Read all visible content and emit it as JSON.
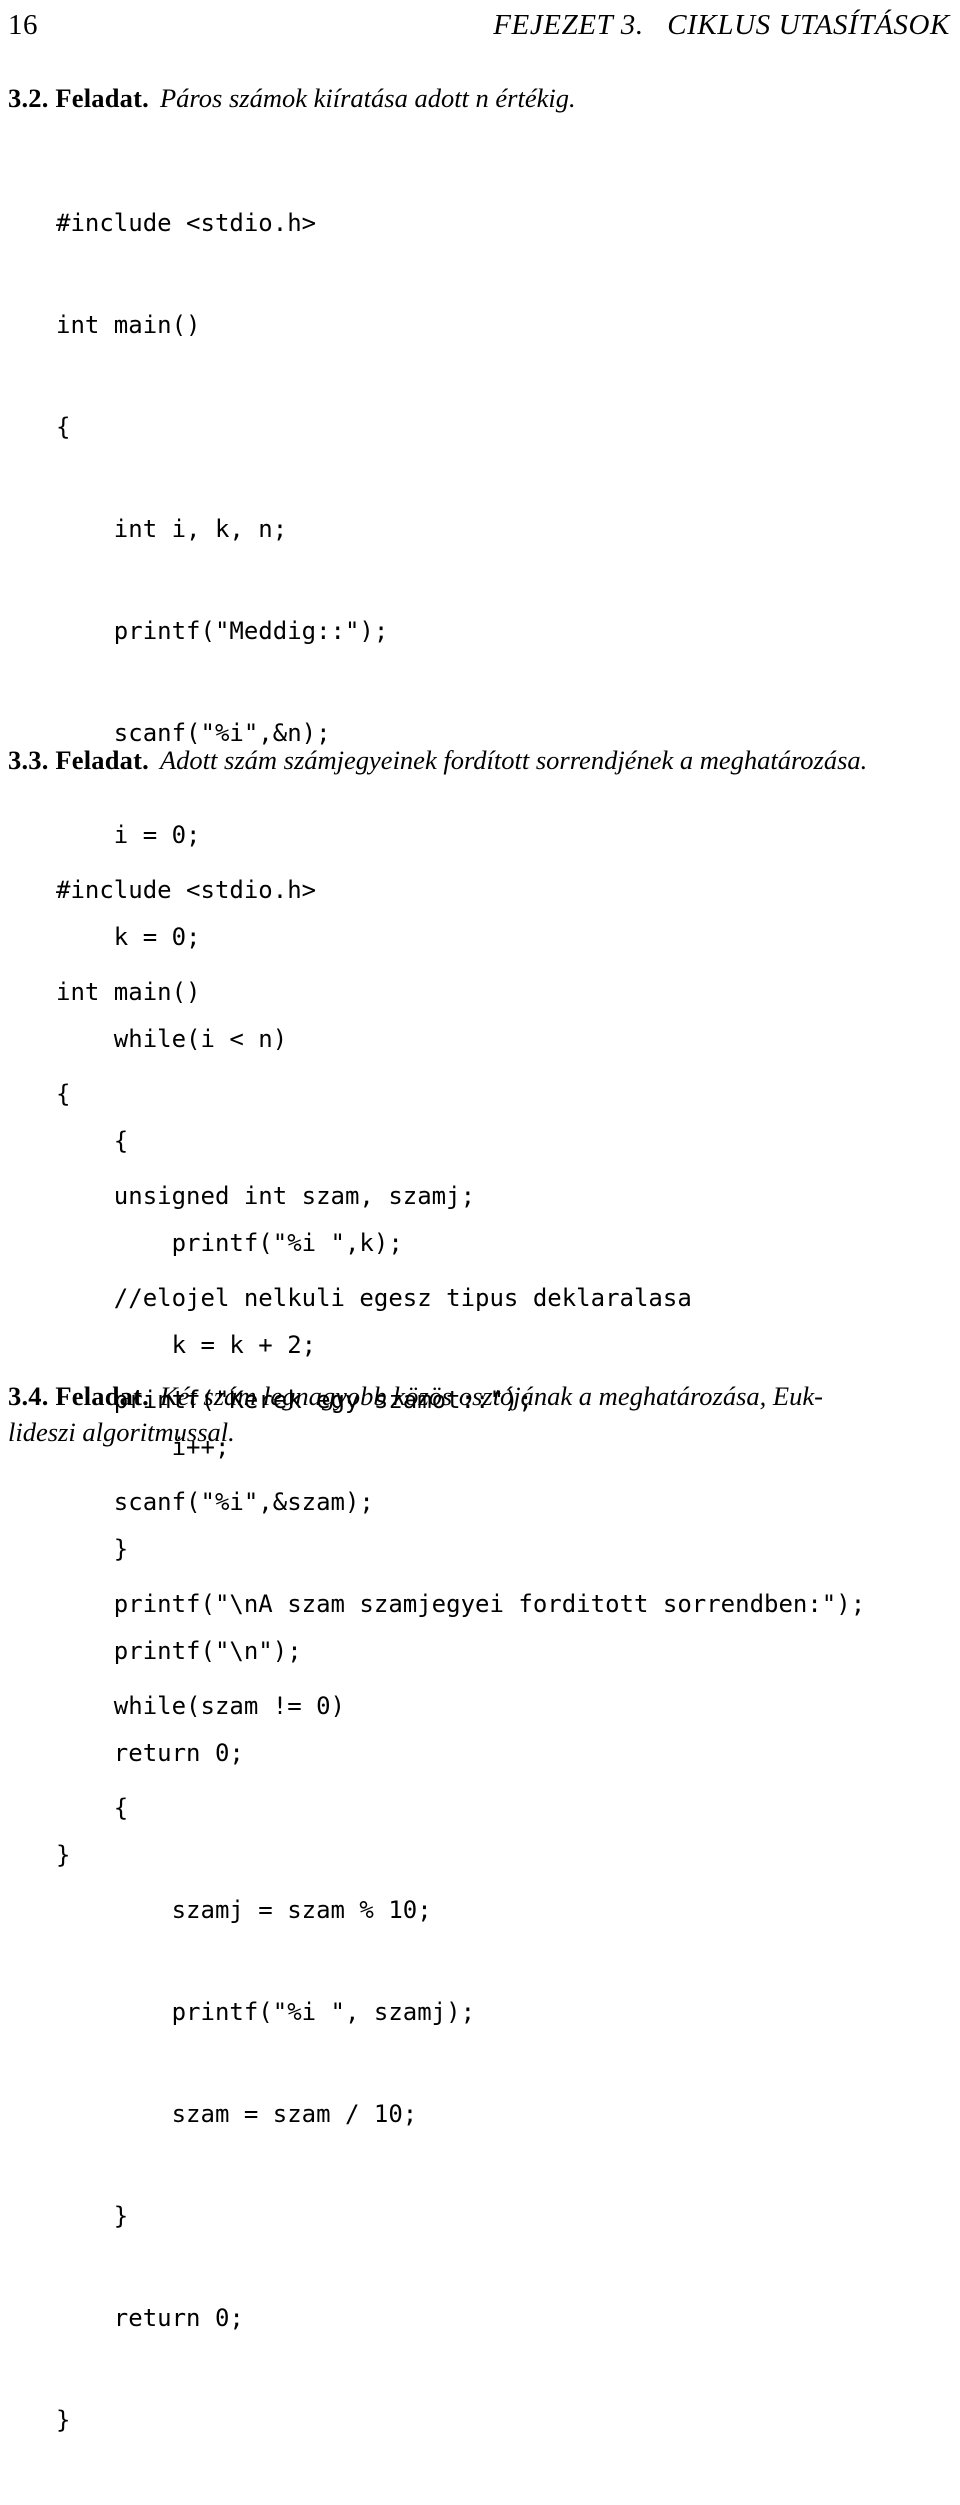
{
  "page": {
    "folio": "16",
    "running_head": "FEJEZET 3.   CIKLUS UTASÍTÁSOK"
  },
  "exercises": [
    {
      "number": "3.2. Feladat.",
      "text": "Páros számok kiíratása adott n értékig."
    },
    {
      "number": "3.3. Feladat.",
      "text": "Adott szám számjegyeinek fordított sorrendjének a meghatározása."
    },
    {
      "number": "3.4. Feladat.",
      "text_line1": "Két szám legnagyobb közös osztójának a meghatározása, Euk-",
      "text_line2": "lideszi algoritmussal."
    }
  ],
  "code_blocks": [
    {
      "lines": [
        "#include <stdio.h>",
        "int main()",
        "{",
        "    int i, k, n;",
        "    printf(\"Meddig::\");",
        "    scanf(\"%i\",&n);",
        "    i = 0;",
        "    k = 0;",
        "    while(i < n)",
        "    {",
        "        printf(\"%i \",k);",
        "        k = k + 2;",
        "        i++;",
        "    }",
        "    printf(\"\\n\");",
        "    return 0;",
        "}"
      ]
    },
    {
      "lines": [
        "#include <stdio.h>",
        "int main()",
        "{",
        "    unsigned int szam, szamj;",
        "    //elojel nelkuli egesz tipus deklaralasa",
        "    printf(\"Kerek egy szamot::\");",
        "    scanf(\"%i\",&szam);",
        "    printf(\"\\nA szam szamjegyei forditott sorrendben:\");",
        "    while(szam != 0)",
        "    {",
        "        szamj = szam % 10;",
        "        printf(\"%i \", szamj);",
        "        szam = szam / 10;",
        "    }",
        "    return 0;",
        "}"
      ]
    }
  ]
}
